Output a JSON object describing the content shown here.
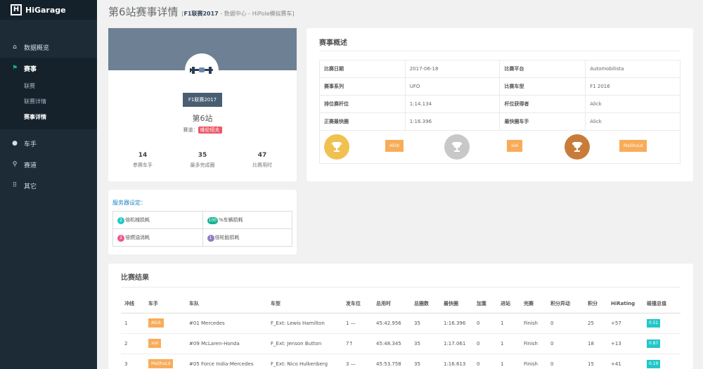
{
  "app": {
    "logo_text": "H",
    "name": "HiGarage"
  },
  "sidebar": {
    "items": [
      {
        "label": "数据概览",
        "icon": "home-icon"
      },
      {
        "label": "赛事",
        "icon": "flag-icon",
        "active": true
      },
      {
        "label": "车手",
        "icon": "user-icon"
      },
      {
        "label": "赛道",
        "icon": "map-marker-icon"
      },
      {
        "label": "其它",
        "icon": "grid-icon"
      }
    ],
    "sub_items": [
      "联赛",
      "联赛详情",
      "赛事详情"
    ]
  },
  "header": {
    "title": "第6站赛事详情",
    "crumb_open": "[",
    "crumb_bold": "F1联赛2017",
    "crumb_rest": " - 数据中心 - HiPole模拟赛车]"
  },
  "profile": {
    "league": "F1联赛2017",
    "stage": "第6站",
    "track_label": "赛道：",
    "track_name": "维伦纽夫",
    "stats": [
      {
        "value": "14",
        "label": "参赛车手"
      },
      {
        "value": "35",
        "label": "最多完成圈"
      },
      {
        "value": "47",
        "label": "比赛用时"
      }
    ]
  },
  "server": {
    "title": "服务器设定：",
    "items": [
      {
        "badge": "2",
        "text": "倍机械损耗",
        "color": "#23c6c8"
      },
      {
        "badge": "100",
        "text": "%车辆损耗",
        "color": "#1ab394"
      },
      {
        "badge": "2",
        "text": "倍燃油消耗",
        "color": "#ed5590"
      },
      {
        "badge": "1",
        "text": "倍轮胎损耗",
        "color": "#8e7cc3"
      }
    ]
  },
  "overview": {
    "title": "赛事概述",
    "rows": [
      [
        "比赛日期",
        "2017-06-18",
        "比赛平台",
        "Automobilista"
      ],
      [
        "赛事系列",
        "UFO",
        "比赛车型",
        "F1 2016"
      ],
      [
        "排位赛杆位",
        "1:14.134",
        "杆位获得者",
        "Alick"
      ],
      [
        "正赛最快圈",
        "1:16.396",
        "最快圈车手",
        "Alick"
      ]
    ],
    "podium": [
      {
        "name": "Alick",
        "color": "#f0c150"
      },
      {
        "name": "xixi",
        "color": "#c8c8c8"
      },
      {
        "name": "MaShuLd",
        "color": "#c97c3a"
      }
    ]
  },
  "results": {
    "title": "比赛结果",
    "headers": [
      "冲线",
      "车手",
      "车队",
      "车型",
      "发车位",
      "总用时",
      "总圈数",
      "最快圈",
      "加重",
      "进站",
      "完赛",
      "积分异动",
      "积分",
      "HiRating",
      "碰撞总值"
    ],
    "rows": [
      [
        "1",
        "Alick",
        "#01 Mercedes",
        "F_Ext: Lewis Hamilton",
        "1",
        "45:42.956",
        "35",
        "1:16.396",
        "0",
        "1",
        "Finish",
        "0",
        "25",
        "+57",
        "0.51",
        "—"
      ],
      [
        "2",
        "xixi",
        "#09 McLaren-Honda",
        "F_Ext: Jenson Button",
        "7",
        "45:48.345",
        "35",
        "1:17.061",
        "0",
        "1",
        "Finish",
        "0",
        "18",
        "+13",
        "0.87",
        "↑"
      ],
      [
        "3",
        "MaShuLd",
        "#05 Force India-Mercedes",
        "F_Ext: Nico Hulkenberg",
        "3",
        "45:53.758",
        "35",
        "1:16.613",
        "0",
        "1",
        "Finish",
        "0",
        "15",
        "+41",
        "0.19",
        "—"
      ]
    ]
  },
  "colors": {
    "sidebar": "#1c2b36",
    "accent": "#1ab394",
    "orange": "#f8ac59",
    "cyan": "#23c6c8"
  }
}
